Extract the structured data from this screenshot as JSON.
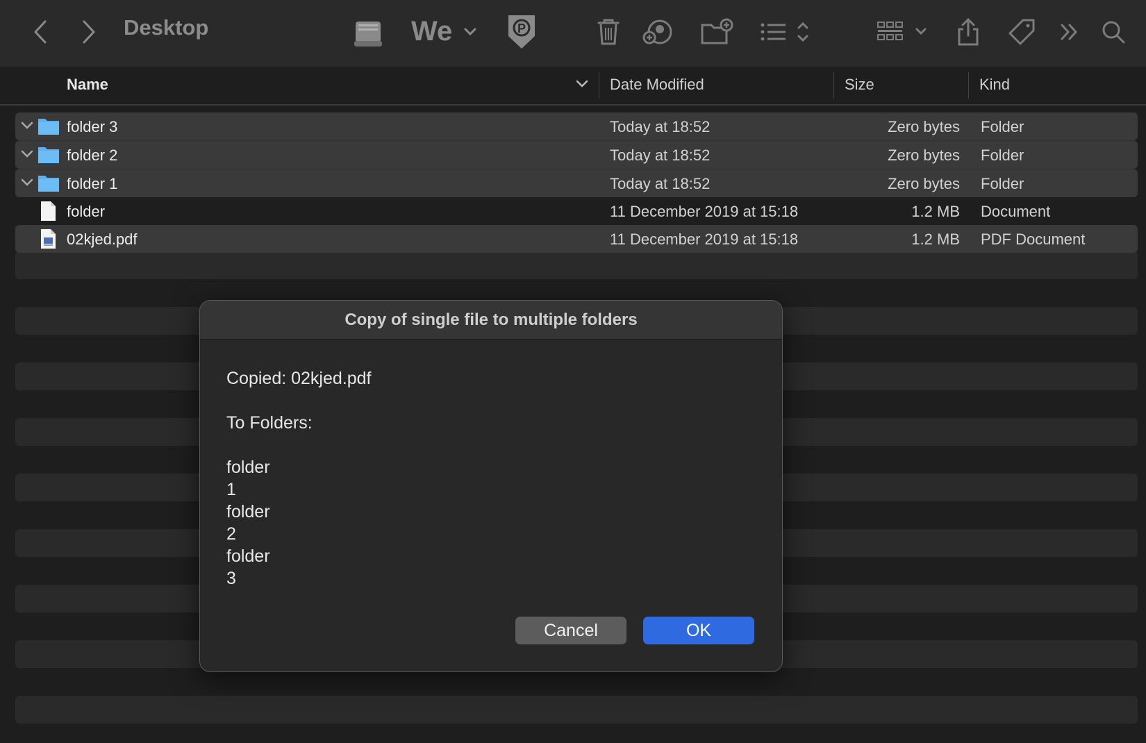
{
  "toolbar": {
    "title": "Desktop",
    "icons": [
      "back-icon",
      "forward-icon",
      "drive-icon",
      "wetransfer-icon",
      "parking-icon",
      "trash-icon",
      "share-user-icon",
      "new-folder-icon",
      "list-view-icon",
      "grid-view-icon",
      "share-icon",
      "tag-icon",
      "more-icon",
      "search-icon"
    ]
  },
  "columns": {
    "name": "Name",
    "date": "Date Modified",
    "size": "Size",
    "kind": "Kind"
  },
  "rows": [
    {
      "name": "folder 3",
      "date": "Today at 18:52",
      "size": "Zero bytes",
      "kind": "Folder",
      "type": "folder",
      "selected": true
    },
    {
      "name": "folder 2",
      "date": "Today at 18:52",
      "size": "Zero bytes",
      "kind": "Folder",
      "type": "folder",
      "selected": true
    },
    {
      "name": "folder 1",
      "date": "Today at 18:52",
      "size": "Zero bytes",
      "kind": "Folder",
      "type": "folder",
      "selected": true
    },
    {
      "name": "folder",
      "date": "11 December 2019 at 15:18",
      "size": "1.2 MB",
      "kind": "Document",
      "type": "document",
      "selected": false
    },
    {
      "name": "02kjed.pdf",
      "date": "11 December 2019 at 15:18",
      "size": "1.2 MB",
      "kind": "PDF Document",
      "type": "pdf",
      "selected": true
    }
  ],
  "dialog": {
    "title": "Copy of single file to multiple folders",
    "copied_label": "Copied:  02kjed.pdf",
    "to_label": "To Folders:",
    "folders_lines": [
      "folder",
      "1",
      "folder",
      "2",
      "folder",
      "3"
    ],
    "cancel_label": "Cancel",
    "ok_label": "OK"
  },
  "colors": {
    "accent": "#2f6ae0",
    "folder": "#5fb0f0",
    "selection": "#3a3a3a"
  }
}
